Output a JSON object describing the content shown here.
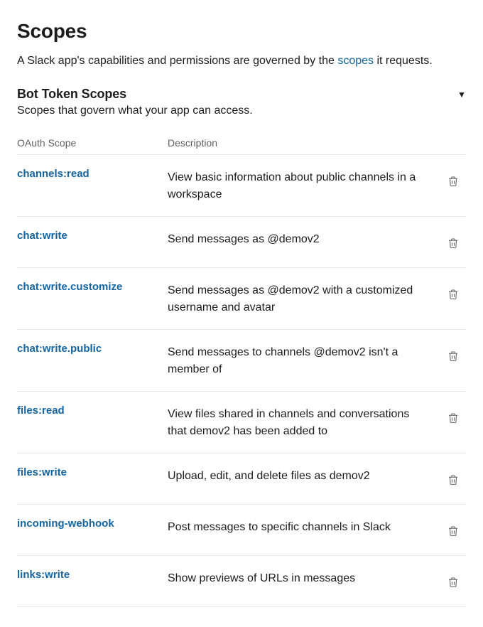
{
  "page": {
    "title": "Scopes",
    "intro_prefix": "A Slack app's capabilities and permissions are governed by the ",
    "intro_link": "scopes",
    "intro_suffix": " it requests."
  },
  "section": {
    "title": "Bot Token Scopes",
    "subtitle": "Scopes that govern what your app can access."
  },
  "table": {
    "headers": {
      "scope": "OAuth Scope",
      "description": "Description"
    },
    "rows": [
      {
        "scope": "channels:read",
        "description": "View basic information about public channels in a workspace"
      },
      {
        "scope": "chat:write",
        "description": "Send messages as @demov2"
      },
      {
        "scope": "chat:write.customize",
        "description": "Send messages as @demov2 with a customized username and avatar"
      },
      {
        "scope": "chat:write.public",
        "description": "Send messages to channels @demov2 isn't a member of"
      },
      {
        "scope": "files:read",
        "description": "View files shared in channels and conversations that demov2 has been added to"
      },
      {
        "scope": "files:write",
        "description": "Upload, edit, and delete files as demov2"
      },
      {
        "scope": "incoming-webhook",
        "description": "Post messages to specific channels in Slack"
      },
      {
        "scope": "links:write",
        "description": "Show previews of URLs in messages"
      }
    ]
  }
}
